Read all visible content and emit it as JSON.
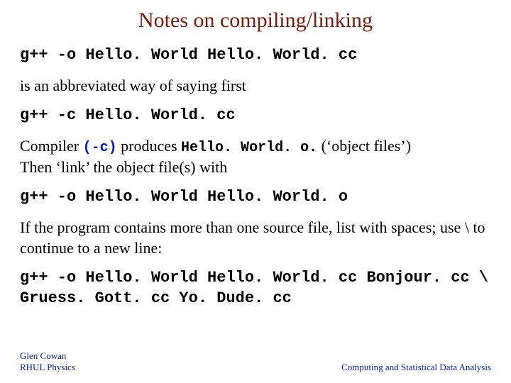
{
  "title": "Notes on compiling/linking",
  "line1": "g++ -o Hello. World Hello. World. cc",
  "line2": "is an abbreviated way of saying first",
  "line3": "g++ -c Hello. World. cc",
  "line4_a": "Compiler ",
  "line4_b": "(-c)",
  "line4_c": " produces ",
  "line4_d": "Hello. World. o.",
  "line4_e": "    (‘object files’)",
  "line5": "Then ‘link’ the object file(s) with",
  "line6": "g++ -o Hello. World Hello. World. o",
  "line7": "If the program contains more than one source file, list with spaces; use \\ to continue to a new line:",
  "line8": "g++ -o Hello. World Hello. World. cc Bonjour. cc \\ Gruess. Gott. cc Yo. Dude. cc",
  "footer_left_1": "Glen Cowan",
  "footer_left_2": "RHUL Physics",
  "footer_right": "Computing and Statistical Data Analysis"
}
